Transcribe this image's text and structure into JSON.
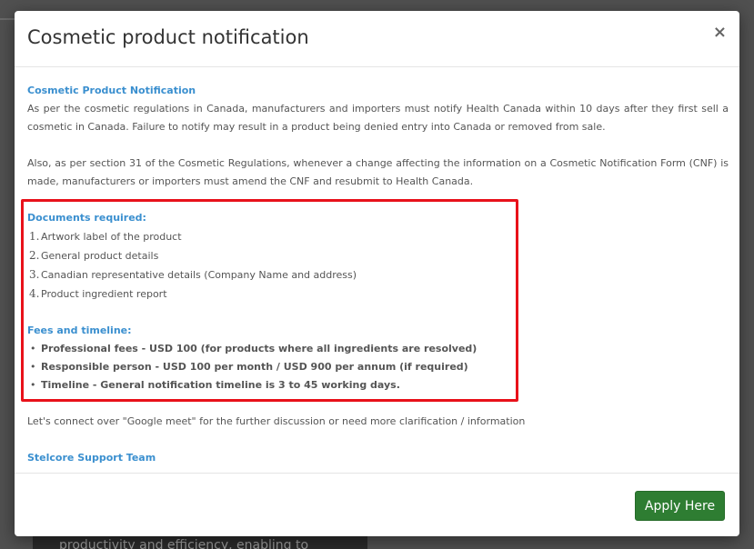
{
  "modal": {
    "title": "Cosmetic product notification",
    "close_label": "×",
    "heading": "Cosmetic Product Notification",
    "para1": "As per the cosmetic regulations in Canada, manufacturers and importers must notify Health Canada within 10 days after they first sell a cosmetic in Canada. Failure to notify may result in a product being denied entry into Canada or removed from sale.",
    "para2": "Also, as per section 31 of the Cosmetic Regulations, whenever a change affecting the information on a Cosmetic Notification Form (CNF) is made, manufacturers or importers must amend the CNF and resubmit to Health Canada.",
    "documents_title": "Documents required:",
    "documents": [
      {
        "num": "1.",
        "text": "Artwork label of the product"
      },
      {
        "num": "2.",
        "text": "General product details"
      },
      {
        "num": "3.",
        "text": "Canadian representative details (Company Name and address)"
      },
      {
        "num": "4.",
        "text": "Product ingredient report"
      }
    ],
    "fees_title": "Fees and timeline:",
    "fees": [
      "Professional fees - USD 100 (for products where all ingredients are resolved)",
      "Responsible person - USD 100 per month / USD 900 per annum (if required)",
      "Timeline - General notification timeline is 3 to 45 working days."
    ],
    "contact_text": "Let's connect over \"Google meet\" for the further discussion or need more clarification / information",
    "team": "Stelcore Support Team",
    "apply_label": "Apply Here"
  },
  "background": {
    "text": "productivity and efficiency, enabling to"
  },
  "colors": {
    "accent_link": "#3a8fcf",
    "highlight_border": "#e8111a",
    "apply_button": "#2e7d32"
  }
}
